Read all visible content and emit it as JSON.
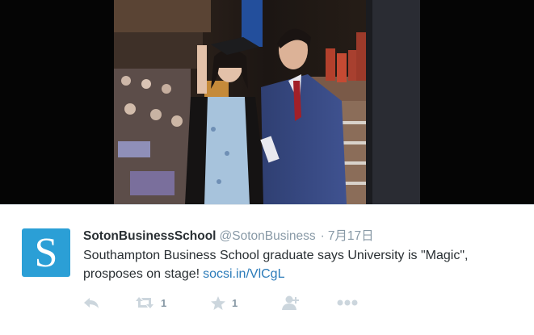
{
  "tweet": {
    "avatar_letter": "S",
    "display_name": "SotonBusinessSchool",
    "screen_name": "@SotonBusiness",
    "separator": "·",
    "timestamp": "7月17日",
    "text": "Southampton Business School graduate says University is \"Magic\", prosposes on stage!",
    "link": "socsi.in/VlCgL",
    "retweet_count": "1",
    "favorite_count": "1"
  },
  "icons": {
    "reply": "reply-icon",
    "retweet": "retweet-icon",
    "favorite": "star-icon",
    "follow": "follow-icon",
    "more": "more-icon"
  },
  "colors": {
    "avatar_bg": "#2b9fd6",
    "link": "#2b7bb9",
    "muted": "#8899a6",
    "action_icon": "#ccd6dd"
  }
}
